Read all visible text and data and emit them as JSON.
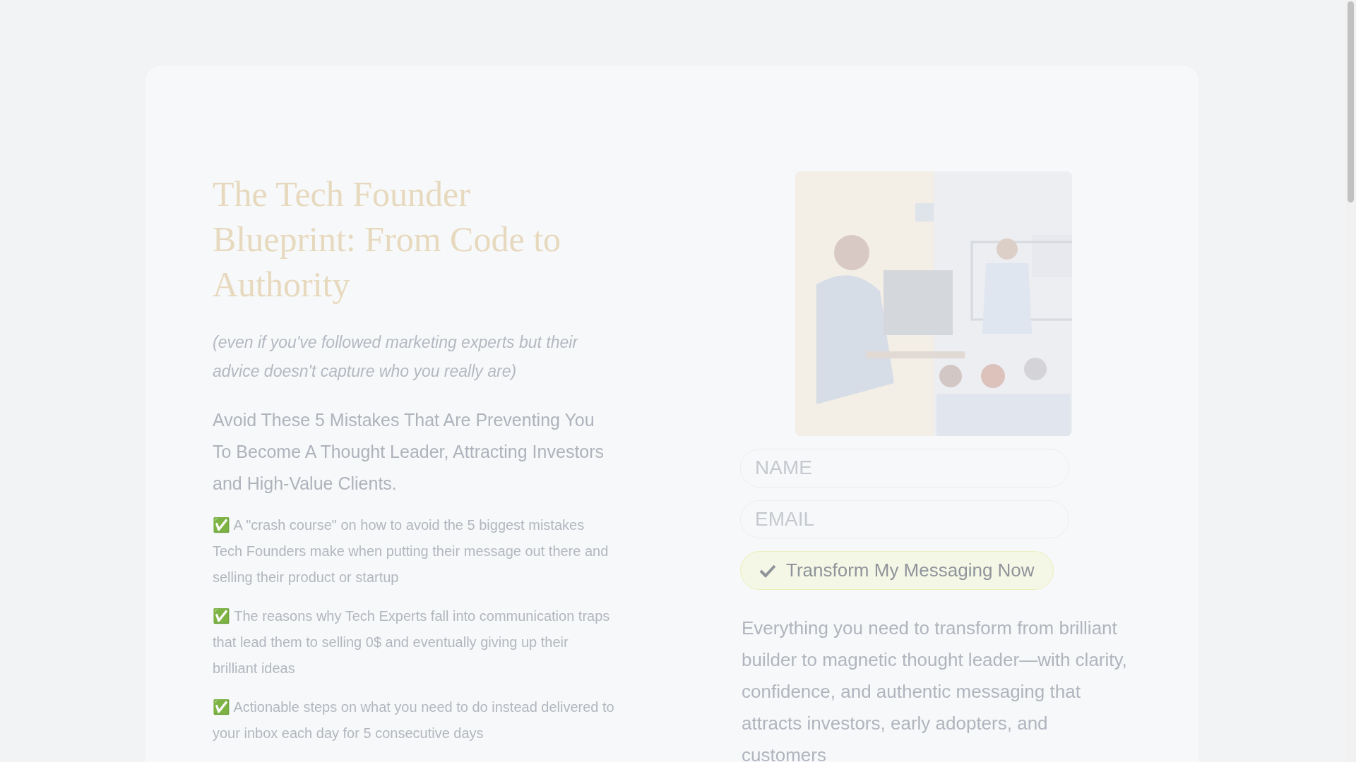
{
  "hero": {
    "title": "The Tech Founder Blueprint: From Code to Authority",
    "subtitle": "(even if you've followed marketing experts but their advice doesn't capture who you really are)",
    "heading": "Avoid These 5 Mistakes That Are Preventing You To Become A Thought Leader, Attracting Investors and High-Value Clients.",
    "bullets": [
      "✅ A \"crash course\" on how to avoid the 5 biggest mistakes Tech Founders make when putting their message out there and selling their product or startup",
      "✅ The reasons why Tech Experts fall into communication traps that lead them to selling 0$ and eventually giving up their brilliant ideas",
      "✅ Actionable steps on what you need to do instead delivered to your inbox each day for 5 consecutive days"
    ]
  },
  "form": {
    "fields": [
      {
        "placeholder": "NAME"
      },
      {
        "placeholder": "EMAIL"
      }
    ],
    "button": "Transform My Messaging Now",
    "description": "Everything you need to transform from brilliant builder to magnetic thought leader—with clarity, confidence, and authentic messaging that attracts investors, early adopters, and customers"
  }
}
